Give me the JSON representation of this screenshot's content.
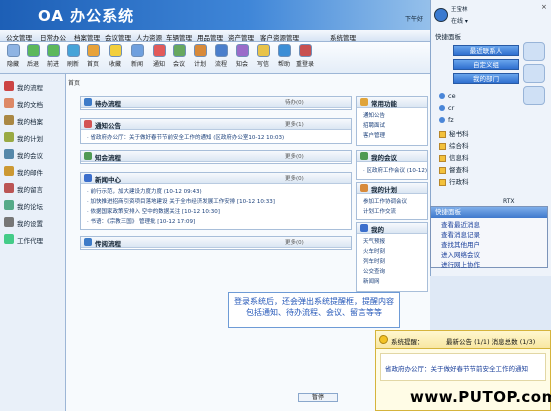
{
  "app": {
    "title": "OA 办公系统"
  },
  "topbar": {
    "right_text": "下午好"
  },
  "menu": [
    "公文管理",
    "日常办公",
    "档案管理",
    "会议管理",
    "人力资源",
    "车辆管理",
    "用品管理",
    "资产管理",
    "客户资源管理",
    "系统管理"
  ],
  "toolbar": [
    "隐藏",
    "后退",
    "前进",
    "刷新",
    "首页",
    "收藏",
    "新闻",
    "通知",
    "会议",
    "计划",
    "流程",
    "知会",
    "写信",
    "帮助",
    "重登录"
  ],
  "sidebar": [
    "我的流程",
    "我的文档",
    "我的档案",
    "我的计划",
    "我的会议",
    "我的邮件",
    "我的留言",
    "我的论坛",
    "我的设置",
    "工作代理"
  ],
  "breadcrumb": "首页",
  "panels": {
    "todo": {
      "title": "待办流程",
      "more": "待办(0)"
    },
    "notice": {
      "title": "通知公告",
      "more": "更多(1)",
      "line": "· 省政府办公厅：关于做好春节节前安全工作的通知 (区政府办公室10-12 10:03)"
    },
    "inform": {
      "title": "知会流程",
      "more": "更多(0)"
    },
    "news": {
      "title": "新闻中心",
      "more": "更多(0)",
      "lines": [
        "· 前行示范，加大建设力度力度 (10-12 09:43)",
        "· 加快推进招商引资项目落地建设 关于全市经济发展工作安排 [10-12 10:33]",
        "· 依据国家政策安排入 空中的数据关注 [10-12 10:30]",
        "· 书语：《宗教三国》 管理批 [10-12 17:09]"
      ]
    },
    "process": {
      "title": "传阅流程",
      "more": "更多(0)"
    },
    "common": {
      "title": "常用功能",
      "links": [
        "通知公告",
        "招聘面试",
        "客户管理"
      ]
    },
    "meeting": {
      "title": "我的会议",
      "line": "· 区政府工作会议 (10-12)"
    },
    "plan": {
      "title": "我的计划",
      "lines": [
        "参加工作协调会议",
        "计划工作交流"
      ]
    },
    "mine": {
      "title": "我的",
      "links": [
        "天气预报",
        "火车时刻",
        "列车时刻",
        "公交查询",
        "新闻网"
      ]
    }
  },
  "right_panel": {
    "user_name": "王宝林",
    "status": "在线 ▾",
    "close": "×",
    "title": "快捷面板",
    "buttons": [
      "最近联系人",
      "自定义组",
      "我的部门"
    ],
    "users": [
      "ce",
      "cr",
      "fz"
    ],
    "groups": [
      "秘书科",
      "综合科",
      "信息科",
      "督查科",
      "行政科"
    ],
    "rtx": "RTX"
  },
  "popup": {
    "title": "快捷面板",
    "links": [
      "查看最近消息",
      "查看消息记录",
      "查找其他用户",
      "进入网络会议",
      "进行网上协作"
    ]
  },
  "annotation": "登录系统后，还会弹出系统提醒框，提醒内容包括通知、待办流程、会议、留言等等",
  "notify": {
    "title": "系统提醒：",
    "count": "最新公告 (1/1)  消息总数 (1/3)",
    "link": "省政府办公厅：关于做好春节节前安全工作的通知"
  },
  "watermark": "www.PUTOP.com",
  "bottom": "暂停"
}
